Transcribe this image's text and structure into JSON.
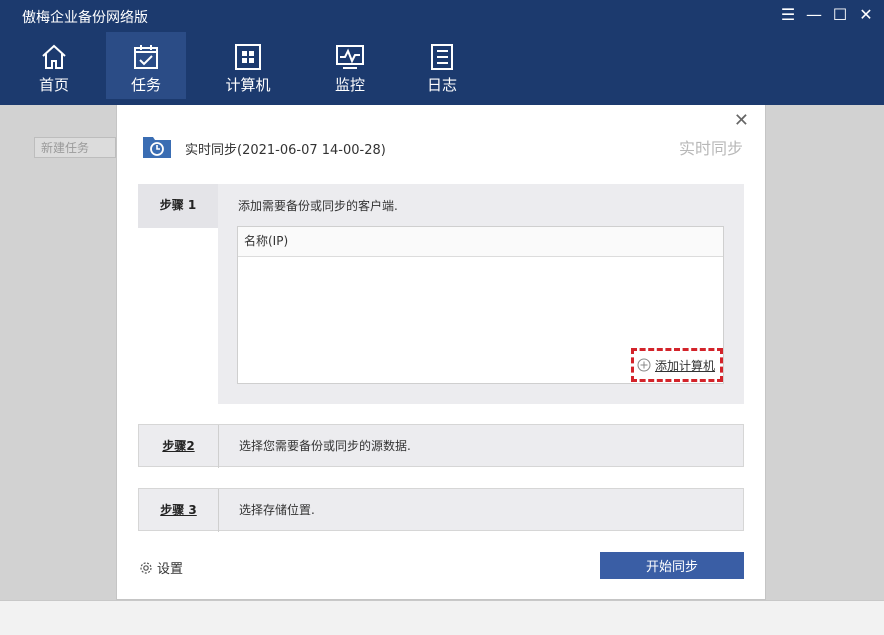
{
  "app": {
    "title": "傲梅企业备份网络版"
  },
  "window_controls": {
    "menu": "☰",
    "minimize": "—",
    "maximize": "☐",
    "close": "✕"
  },
  "nav": {
    "items": [
      {
        "label": "首页",
        "icon": "home-icon"
      },
      {
        "label": "任务",
        "icon": "task-icon",
        "active": true
      },
      {
        "label": "计算机",
        "icon": "computer-icon"
      },
      {
        "label": "监控",
        "icon": "monitor-icon"
      },
      {
        "label": "日志",
        "icon": "log-icon"
      }
    ]
  },
  "background": {
    "new_task_label": "新建任务"
  },
  "dialog": {
    "close": "✕",
    "task_name": "实时同步(2021-06-07 14-00-28)",
    "task_type": "实时同步",
    "steps": [
      {
        "label": "步骤 1",
        "desc": "添加需要备份或同步的客户端."
      },
      {
        "label": "步骤2",
        "desc": "选择您需要备份或同步的源数据."
      },
      {
        "label": "步骤 3",
        "desc": "选择存储位置."
      }
    ],
    "table": {
      "column_header": "名称(IP)"
    },
    "add_computer_label": "添加计算机",
    "settings_label": "设置",
    "start_button_label": "开始同步"
  },
  "colors": {
    "header_bg": "#1c3a6e",
    "active_nav": "#2b4c86",
    "primary_button": "#3a5ea5",
    "highlight_border": "#d3232a"
  }
}
